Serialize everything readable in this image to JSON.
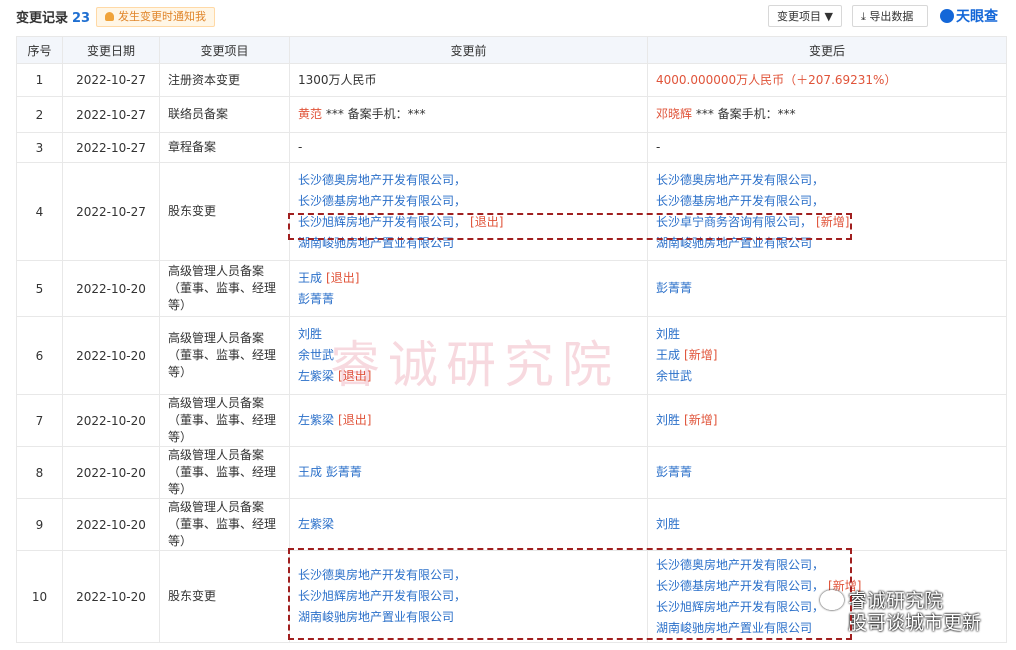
{
  "header": {
    "title": "变更记录",
    "count": "23",
    "notify_label": "发生变更时通知我",
    "filter_label": "变更项目 ▼",
    "export_label": "导出数据",
    "brand": "天眼查"
  },
  "table": {
    "columns": [
      "序号",
      "变更日期",
      "变更项目",
      "变更前",
      "变更后"
    ],
    "rows": [
      {
        "no": "1",
        "date": "2022-10-27",
        "item": "注册资本变更",
        "before": [
          {
            "t": "1300万人民币",
            "c": ""
          }
        ],
        "after": [
          {
            "t": "4000.000000万人民币（＋207.69231%）",
            "c": "red"
          }
        ]
      },
      {
        "no": "2",
        "date": "2022-10-27",
        "item": "联络员备案",
        "before": [
          {
            "t": "黄范",
            "c": "red",
            "rest": " *** 备案手机：***"
          }
        ],
        "after": [
          {
            "t": "邓晓辉",
            "c": "red",
            "rest": " *** 备案手机：***"
          }
        ]
      },
      {
        "no": "3",
        "date": "2022-10-27",
        "item": "章程备案",
        "before": [
          {
            "t": "-",
            "c": ""
          }
        ],
        "after": [
          {
            "t": "-",
            "c": ""
          }
        ]
      },
      {
        "no": "4",
        "date": "2022-10-27",
        "item": "股东变更",
        "before": [
          {
            "t": "长沙德奥房地产开发有限公司，",
            "c": "blue"
          },
          {
            "t": "长沙德基房地产开发有限公司，",
            "c": "blue"
          },
          {
            "t": "长沙旭辉房地产开发有限公司，",
            "c": "blue",
            "tag": "[退出]"
          },
          {
            "t": "湖南峻驰房地产置业有限公司",
            "c": "blue"
          }
        ],
        "after": [
          {
            "t": "长沙德奥房地产开发有限公司，",
            "c": "blue"
          },
          {
            "t": "长沙德基房地产开发有限公司，",
            "c": "blue"
          },
          {
            "t": "长沙卓宁商务咨询有限公司，",
            "c": "blue",
            "tag": "[新增]"
          },
          {
            "t": "湖南峻驰房地产置业有限公司",
            "c": "blue"
          }
        ]
      },
      {
        "no": "5",
        "date": "2022-10-20",
        "item": "高级管理人员备案（董事、监事、经理等）",
        "before": [
          {
            "t": "王成",
            "c": "blue",
            "tag": "[退出]"
          },
          {
            "t": "彭菁菁",
            "c": "blue"
          }
        ],
        "after": [
          {
            "t": "彭菁菁",
            "c": "blue"
          }
        ]
      },
      {
        "no": "6",
        "date": "2022-10-20",
        "item": "高级管理人员备案（董事、监事、经理等）",
        "before": [
          {
            "t": "刘胜",
            "c": "blue"
          },
          {
            "t": "余世武",
            "c": "blue"
          },
          {
            "t": "左紫梁",
            "c": "blue",
            "tag": "[退出]"
          }
        ],
        "after": [
          {
            "t": "刘胜",
            "c": "blue"
          },
          {
            "t": "王成",
            "c": "blue",
            "tag": "[新增]"
          },
          {
            "t": "余世武",
            "c": "blue"
          }
        ]
      },
      {
        "no": "7",
        "date": "2022-10-20",
        "item": "高级管理人员备案（董事、监事、经理等）",
        "before": [
          {
            "t": "左紫梁",
            "c": "blue",
            "tag": "[退出]"
          }
        ],
        "after": [
          {
            "t": "刘胜",
            "c": "blue",
            "tag": "[新增]"
          }
        ]
      },
      {
        "no": "8",
        "date": "2022-10-20",
        "item": "高级管理人员备案（董事、监事、经理等）",
        "before": [
          {
            "t": "王成 彭菁菁",
            "c": "blue"
          }
        ],
        "after": [
          {
            "t": "彭菁菁",
            "c": "blue"
          }
        ]
      },
      {
        "no": "9",
        "date": "2022-10-20",
        "item": "高级管理人员备案（董事、监事、经理等）",
        "before": [
          {
            "t": "左紫梁",
            "c": "blue"
          }
        ],
        "after": [
          {
            "t": "刘胜",
            "c": "blue"
          }
        ]
      },
      {
        "no": "10",
        "date": "2022-10-20",
        "item": "股东变更",
        "before": [
          {
            "t": "长沙德奥房地产开发有限公司，",
            "c": "blue"
          },
          {
            "t": "长沙旭辉房地产开发有限公司，",
            "c": "blue"
          },
          {
            "t": "湖南峻驰房地产置业有限公司",
            "c": "blue"
          }
        ],
        "after": [
          {
            "t": "长沙德奥房地产开发有限公司，",
            "c": "blue"
          },
          {
            "t": "长沙德基房地产开发有限公司，",
            "c": "blue",
            "tag": "[新增]"
          },
          {
            "t": "长沙旭辉房地产开发有限公司，",
            "c": "blue"
          },
          {
            "t": "湖南峻驰房地产置业有限公司",
            "c": "blue"
          }
        ]
      }
    ]
  },
  "watermark": "睿诚研究院",
  "watermark2": {
    "line1": "睿诚研究院",
    "line2": "股哥谈城市更新"
  },
  "colors": {
    "link": "#2a6fc9",
    "red": "#e0543a",
    "highlight": "#a01f1f"
  }
}
